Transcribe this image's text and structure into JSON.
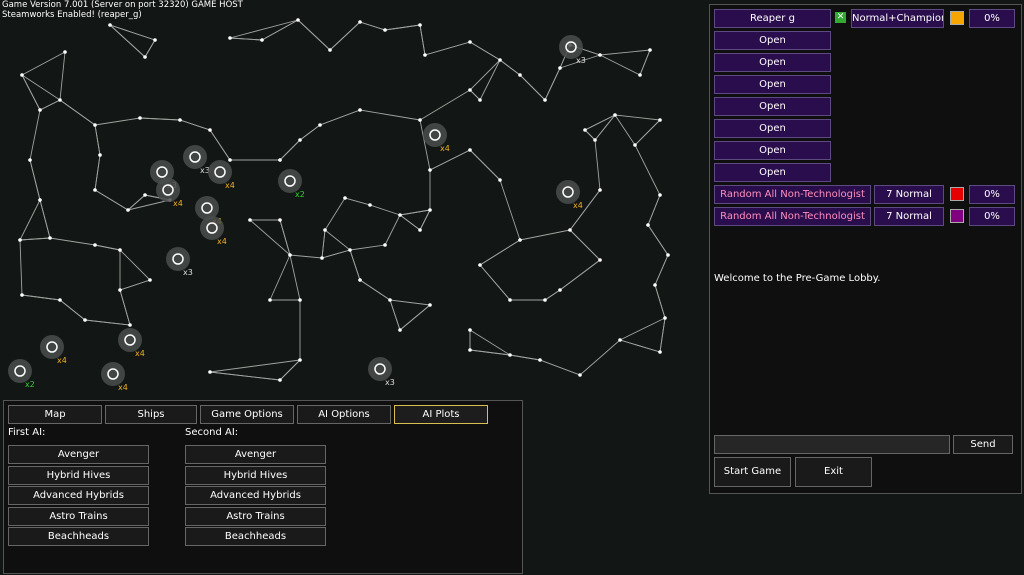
{
  "header": {
    "version_line": "Game Version 7.001 (Server on port 32320) GAME HOST",
    "steam_line": "Steamworks Enabled! (reaper_g)"
  },
  "lobby": {
    "player": {
      "name": "Reaper g",
      "difficulty": "Normal+Champion",
      "color": "#f7a500",
      "handicap": "0%"
    },
    "open_label": "Open",
    "ai_slots": [
      {
        "name": "Random All Non-Technologist",
        "difficulty": "7 Normal",
        "color": "#e50000",
        "handicap": "0%"
      },
      {
        "name": "Random All Non-Technologist",
        "difficulty": "7 Normal",
        "color": "#800080",
        "handicap": "0%"
      }
    ],
    "welcome": "Welcome to the Pre-Game Lobby.",
    "chat_placeholder": "",
    "send_label": "Send",
    "start_label": "Start Game",
    "exit_label": "Exit"
  },
  "tabs": [
    "Map",
    "Ships",
    "Game Options",
    "AI Options",
    "AI Plots"
  ],
  "active_tab": "AI Plots",
  "ai_plots": {
    "first_label": "First AI:",
    "second_label": "Second AI:",
    "plots": [
      "Avenger",
      "Hybrid Hives",
      "Advanced Hybrids",
      "Astro Trains",
      "Beachheads"
    ]
  },
  "map_markers": [
    {
      "label": "x3",
      "tier": "white"
    },
    {
      "label": "x4",
      "tier": "orange"
    },
    {
      "label": "x3",
      "tier": "white"
    },
    {
      "label": "x4",
      "tier": "orange"
    },
    {
      "label": "x3",
      "tier": "white"
    },
    {
      "label": "x4",
      "tier": "orange"
    },
    {
      "label": "x2",
      "tier": "green"
    },
    {
      "label": "x4",
      "tier": "orange"
    },
    {
      "label": "x4",
      "tier": "orange"
    },
    {
      "label": "x4",
      "tier": "orange"
    },
    {
      "label": "x4",
      "tier": "orange"
    },
    {
      "label": "x3",
      "tier": "white"
    },
    {
      "label": "x4",
      "tier": "orange"
    },
    {
      "label": "x4",
      "tier": "orange"
    },
    {
      "label": "x2",
      "tier": "green"
    },
    {
      "label": "x4",
      "tier": "orange"
    },
    {
      "label": "x3",
      "tier": "white"
    }
  ],
  "colors": {
    "orange": "#f0b020",
    "green": "#33d033",
    "white": "#dddddd"
  }
}
